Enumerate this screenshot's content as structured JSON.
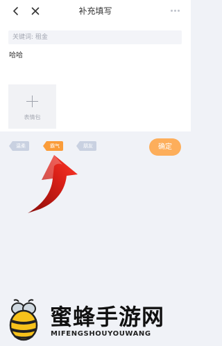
{
  "nav": {
    "title": "补充填写",
    "back_icon": "chevron-left-icon",
    "close_icon": "close-icon",
    "more_icon": "more-dots-icon"
  },
  "keyword": {
    "text": "关键词: 租金"
  },
  "content": {
    "text": "哈哈"
  },
  "emoji": {
    "add_label": "表情包",
    "icon": "plus-icon"
  },
  "tags": [
    {
      "label": "温柔"
    },
    {
      "label": "霸气"
    },
    {
      "label": "朋友"
    }
  ],
  "selected_tag_index": 1,
  "confirm": {
    "label": "确定"
  },
  "colors": {
    "accent": "#fa9c3a",
    "confirm": "#fdae5b",
    "tag_inactive": "#c9d1e1",
    "arrow": "#e0231b"
  },
  "watermark": {
    "title": "蜜蜂手游网",
    "subtitle": "MIFENGSHOUYOUWANG"
  }
}
